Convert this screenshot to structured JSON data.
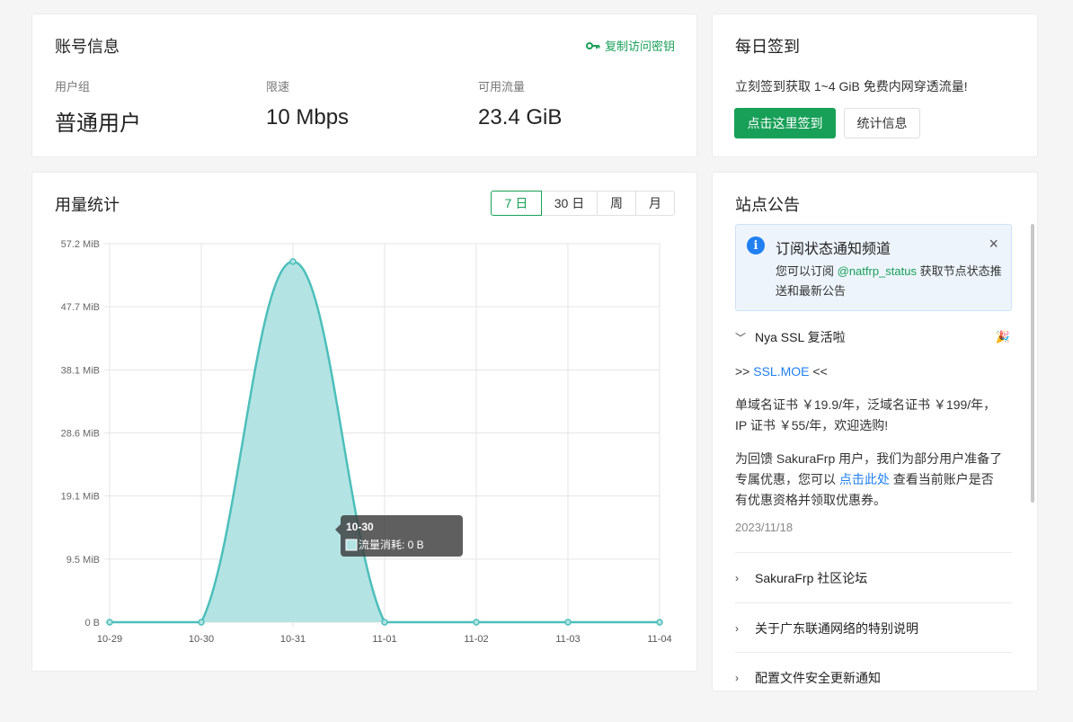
{
  "account": {
    "title": "账号信息",
    "copy_key": "复制访问密钥",
    "stats": [
      {
        "label": "用户组",
        "value": "普通用户"
      },
      {
        "label": "限速",
        "value": "10 Mbps"
      },
      {
        "label": "可用流量",
        "value": "23.4 GiB"
      }
    ]
  },
  "checkin": {
    "title": "每日签到",
    "desc": "立刻签到获取 1~4 GiB 免费内网穿透流量!",
    "primary_button": "点击这里签到",
    "secondary_button": "统计信息"
  },
  "usage": {
    "title": "用量统计",
    "ranges": [
      "7 日",
      "30 日",
      "周",
      "月"
    ],
    "active_range": "7 日"
  },
  "chart_data": {
    "type": "area",
    "x": [
      "10-29",
      "10-30",
      "10-31",
      "11-01",
      "11-02",
      "11-03",
      "11-04"
    ],
    "series": [
      {
        "name": "流量消耗",
        "values_mib": [
          0,
          0,
          54.5,
          0,
          0,
          0,
          0
        ]
      }
    ],
    "yticks": [
      "57.2 MiB",
      "47.7 MiB",
      "38.1 MiB",
      "28.6 MiB",
      "19.1 MiB",
      "9.5 MiB",
      "0 B"
    ],
    "ylim_mib": [
      0,
      57.2
    ],
    "grid": true,
    "line_color": "#4dbfbb",
    "fill_color": "#b3e4e3",
    "tooltip": {
      "title": "10-30",
      "text": "流量消耗: 0 B"
    }
  },
  "notice": {
    "title": "站点公告",
    "alert": {
      "title": "订阅状态通知频道",
      "body_prefix": "您可以订阅 ",
      "body_link": "@natfrp_status",
      "body_suffix": " 获取节点状态推送和最新公告",
      "close": "×"
    },
    "expanded": {
      "title": "Nya SSL 复活啦",
      "party": "🎉",
      "link_prefix": ">> ",
      "link": "SSL.MOE",
      "link_suffix": " <<",
      "para1": "单域名证书 ￥19.9/年，泛域名证书 ￥199/年，IP 证书 ￥55/年，欢迎选购!",
      "para2_prefix": "为回馈 SakuraFrp 用户，我们为部分用户准备了专属优惠，您可以 ",
      "para2_link": "点击此处",
      "para2_suffix": " 查看当前账户是否有优惠资格并领取优惠券。",
      "date": "2023/11/18"
    },
    "collapsed": [
      "SakuraFrp 社区论坛",
      "关于广东联通网络的特别说明",
      "配置文件安全更新通知"
    ]
  }
}
